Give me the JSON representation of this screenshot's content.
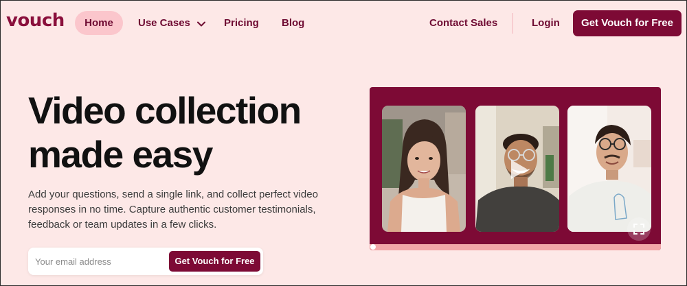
{
  "nav": {
    "logo": "vouch",
    "home": "Home",
    "use_cases": "Use Cases",
    "pricing": "Pricing",
    "blog": "Blog",
    "contact_sales": "Contact Sales",
    "login": "Login",
    "cta": "Get Vouch for Free"
  },
  "hero": {
    "title_line1": "Video collection",
    "title_line2": "made easy",
    "description": "Add your questions, send a single link, and collect perfect video responses in no time. Capture authentic customer testimonials, feedback or team updates in a few clicks.",
    "email_placeholder": "Your email address",
    "cta": "Get Vouch for Free"
  },
  "video": {
    "progress": 0,
    "icons": [
      "play-icon",
      "fullscreen-icon"
    ]
  },
  "colors": {
    "brand": "#7d0a35",
    "background": "#fde8e7",
    "nav_active": "#fbc6cc",
    "progress": "#f2a6a8"
  }
}
